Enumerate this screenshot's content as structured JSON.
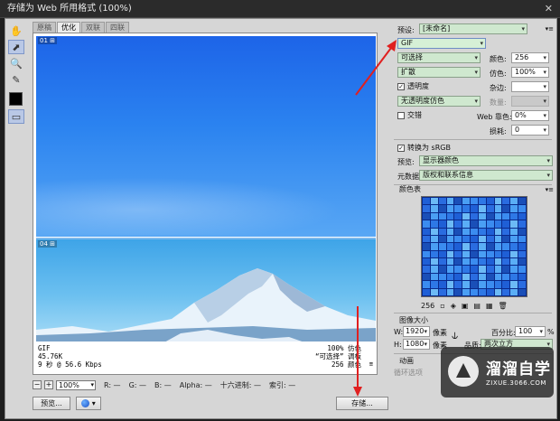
{
  "window": {
    "title": "存储为 Web 所用格式 (100%)",
    "close": "✕"
  },
  "tabs": [
    "原稿",
    "优化",
    "双联",
    "四联"
  ],
  "preview": {
    "top_label": "01 ⊞",
    "bottom_label": "04 ⊞",
    "info_left": [
      "GIF",
      "45.76K",
      "9 秒 @ 56.6 Kbps"
    ],
    "info_menu": "≡",
    "info_right": [
      "100% 仿色",
      "“可选择” 调板",
      "256 颜色"
    ]
  },
  "statusbar": {
    "zoom_minus": "−",
    "zoom_plus": "+",
    "zoom": "100%",
    "r": "R: —",
    "g": "G: —",
    "b": "B: —",
    "alpha": "Alpha: —",
    "hex": "十六进制: —",
    "index": "索引: —"
  },
  "buttons": {
    "preview": "预览...",
    "browser_icon": "browser-icon",
    "save": "存储..."
  },
  "panel": {
    "preset_label": "预设:",
    "preset_value": "[未命名]",
    "menu": "▾≡",
    "format": "GIF",
    "reduction": "可选择",
    "colors_label": "颜色:",
    "colors_value": "256",
    "dither_algo": "扩散",
    "dither_label": "仿色:",
    "dither_value": "100%",
    "transparency_label": "透明度",
    "transparency_checked": "✓",
    "matte_label": "杂边:",
    "trans_dither": "无透明度仿色",
    "amount_label": "数量:",
    "interlaced_label": "交错",
    "websnap_label": "Web 靠色:",
    "websnap_value": "0%",
    "lossy_label": "损耗:",
    "lossy_value": "0",
    "convert_label": "转换为 sRGB",
    "convert_checked": "✓",
    "preview_label": "预览:",
    "preview_value": "显示器颜色",
    "metadata_label": "元数据:",
    "metadata_value": "版权和联系信息",
    "color_table_title": "颜色表",
    "color_count": "256",
    "image_size_title": "图像大小",
    "width_label": "W:",
    "width_value": "1920",
    "height_label": "H:",
    "height_value": "1080",
    "px_unit": "像素",
    "percent_label": "百分比:",
    "percent_value": "100",
    "percent_unit": "%",
    "quality_label": "品质:",
    "quality_value": "两次立方",
    "animation_title": "动画",
    "loop_label": "循环选项"
  },
  "watermark": {
    "title": "溜溜自学",
    "subtitle": "ZIXUE.3066.COM"
  },
  "colors": {
    "accent_arrow": "#e02020",
    "selection_green": "#cfe8cf"
  }
}
